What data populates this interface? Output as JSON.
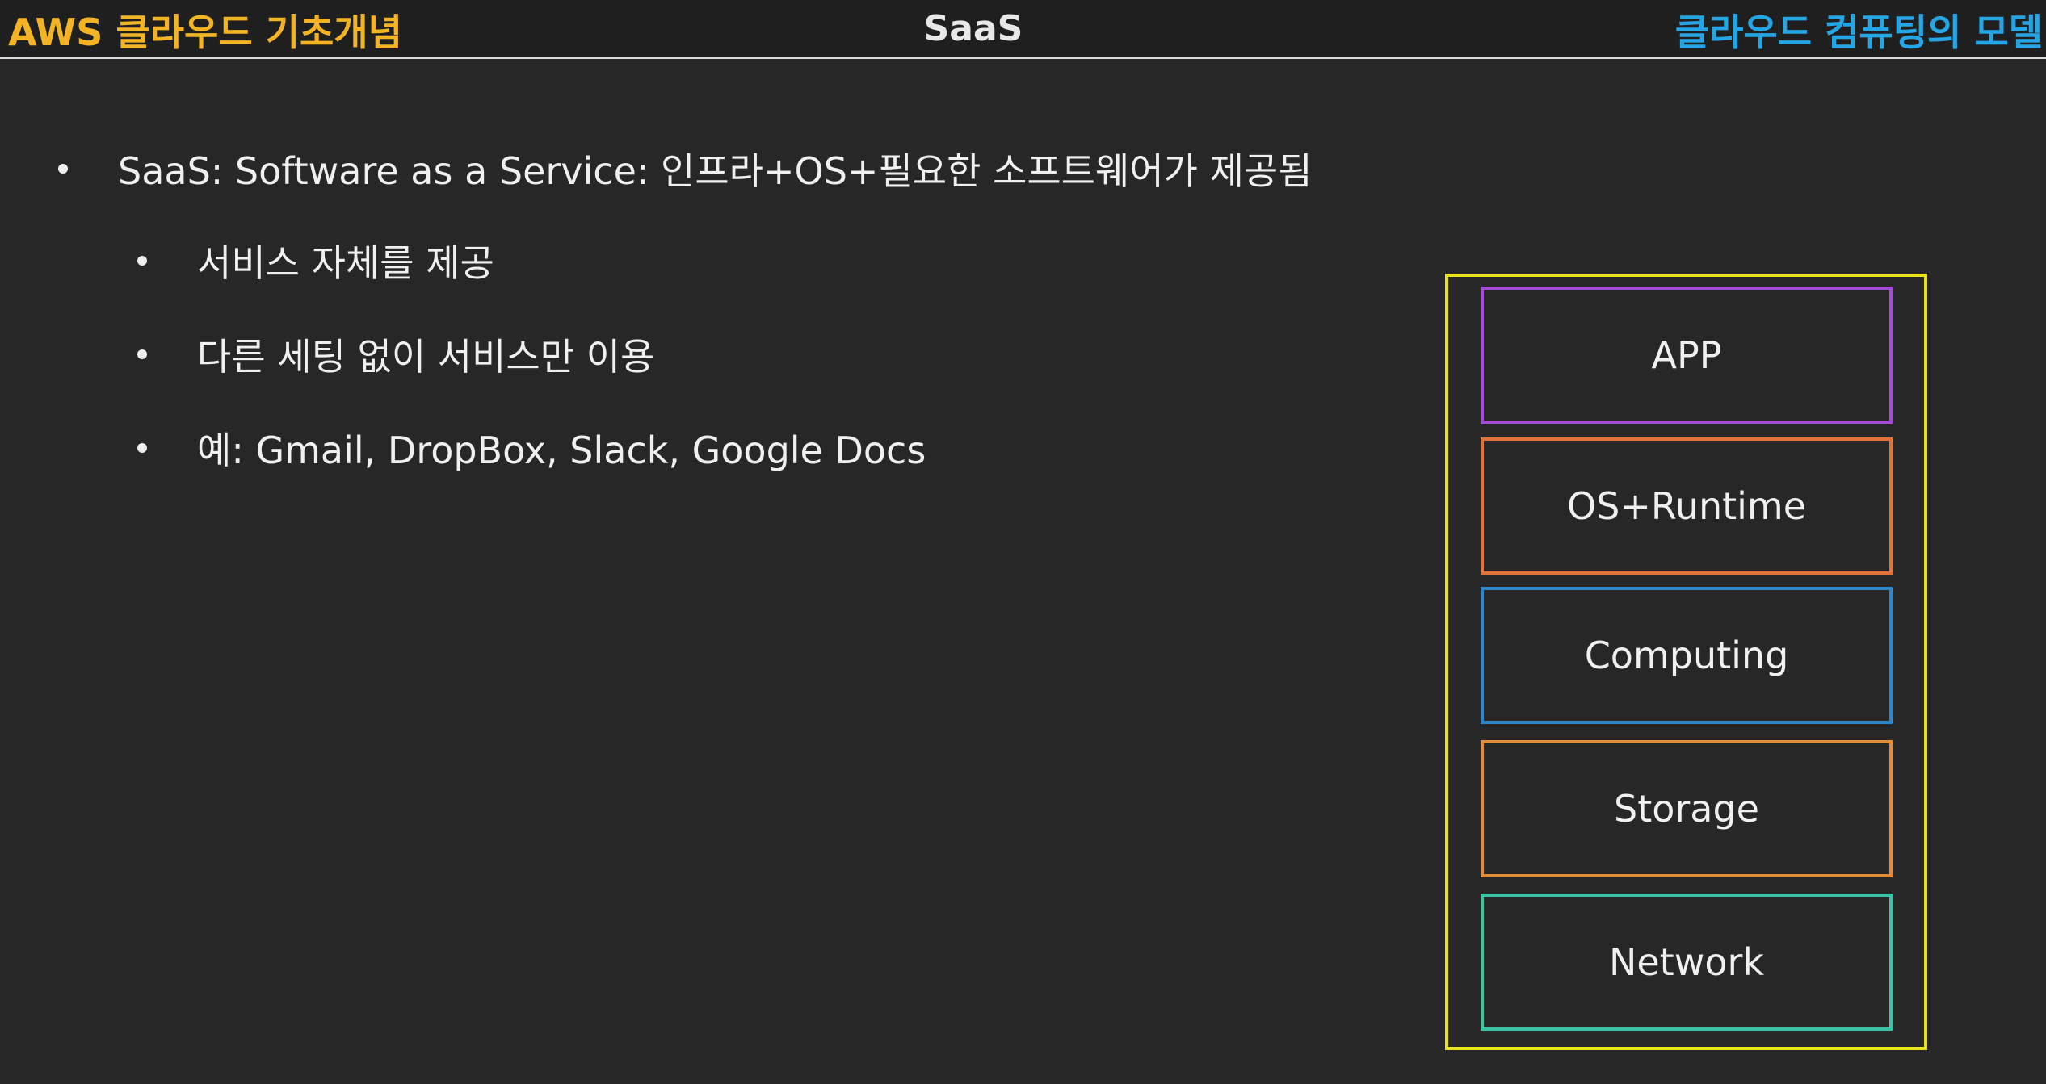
{
  "header": {
    "left_title": "AWS 클라우드 기초개념",
    "center_title": "SaaS",
    "right_title": "클라우드 컴퓨팅의 모델",
    "colors": {
      "left": "#f2b324",
      "right": "#26a5e4"
    }
  },
  "bullets": {
    "main": "SaaS: Software as a Service: 인프라+OS+필요한 소프트웨어가 제공됨",
    "sub": [
      "서비스 자체를 제공",
      "다른 세팅 없이 서비스만 이용",
      "예: Gmail, DropBox, Slack, Google Docs"
    ]
  },
  "stack": {
    "frame_color": "#e8e21a",
    "layers": [
      {
        "label": "APP",
        "color": "#a24fd6"
      },
      {
        "label": "OS+Runtime",
        "color": "#e0733a"
      },
      {
        "label": "Computing",
        "color": "#2f86c9"
      },
      {
        "label": "Storage",
        "color": "#e08f3a"
      },
      {
        "label": "Network",
        "color": "#3cc2a4"
      }
    ]
  }
}
